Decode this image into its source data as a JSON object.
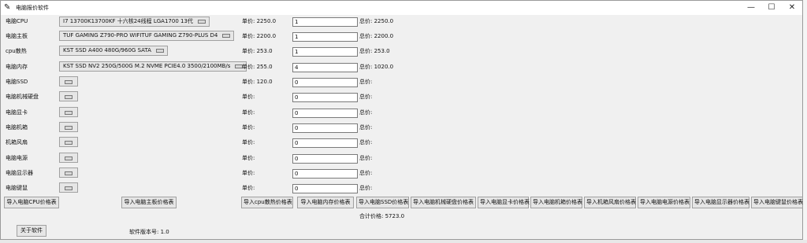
{
  "window": {
    "title": "电脑报价软件",
    "icon": "feather-icon"
  },
  "rows": [
    {
      "label": "电脑CPU",
      "selected": "I7 13700K13700KF 十六核24线程 LGA1700 13代",
      "unit_label": "单价: 2250.0",
      "qty": "1",
      "total_label": "总价: 2250.0"
    },
    {
      "label": "电脑主板",
      "selected": "TUF GAMING Z790-PRO WIFITUF GAMING Z790-PLUS D4",
      "unit_label": "单价: 2200.0",
      "qty": "1",
      "total_label": "总价: 2200.0"
    },
    {
      "label": "cpu散热",
      "selected": "KST SSD A400 480G/960G SATA",
      "unit_label": "单价: 253.0",
      "qty": "1",
      "total_label": "总价: 253.0"
    },
    {
      "label": "电脑内存",
      "selected": "KST SSD NV2 250G/500G M.2 NVME PCIE4.0 3500/2100MB/s",
      "unit_label": "单价: 255.0",
      "qty": "4",
      "total_label": "总价: 1020.0"
    },
    {
      "label": "电脑SSD",
      "selected": "",
      "unit_label": "单价: 120.0",
      "qty": "0",
      "total_label": "总价:"
    },
    {
      "label": "电脑机械硬盘",
      "selected": "",
      "unit_label": "单价:",
      "qty": "0",
      "total_label": "总价:"
    },
    {
      "label": "电脑显卡",
      "selected": "",
      "unit_label": "单价:",
      "qty": "0",
      "total_label": "总价:"
    },
    {
      "label": "电脑机箱",
      "selected": "",
      "unit_label": "单价:",
      "qty": "0",
      "total_label": "总价:"
    },
    {
      "label": "机箱风扇",
      "selected": "",
      "unit_label": "单价:",
      "qty": "0",
      "total_label": "总价:"
    },
    {
      "label": "电脑电源",
      "selected": "",
      "unit_label": "单价:",
      "qty": "0",
      "total_label": "总价:"
    },
    {
      "label": "电脑显示器",
      "selected": "",
      "unit_label": "单价:",
      "qty": "0",
      "total_label": "总价:"
    },
    {
      "label": "电脑键鼠",
      "selected": "",
      "unit_label": "单价:",
      "qty": "0",
      "total_label": "总价:"
    }
  ],
  "import_buttons": [
    "导入电脑CPU价格表",
    "导入电脑主板价格表",
    "导入cpu散热价格表",
    "导入电脑内存价格表",
    "导入电脑SSD价格表",
    "导入电脑机械硬盘价格表",
    "导入电脑显卡价格表",
    "导入电脑机箱价格表",
    "导入机箱风扇价格表",
    "导入电脑电源价格表",
    "导入电脑显示器价格表",
    "导入电脑键鼠价格表"
  ],
  "summary": {
    "total_label": "合计价格: 5723.0"
  },
  "footer": {
    "about_button": "关于软件",
    "version_label": "软件版本号: 1.0"
  }
}
